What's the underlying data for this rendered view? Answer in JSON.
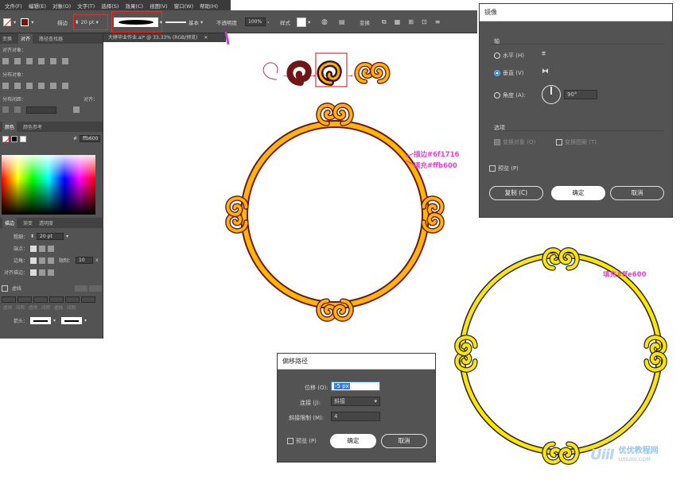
{
  "menubar": [
    "文件(F)",
    "编辑(E)",
    "对象(O)",
    "文字(T)",
    "选择(S)",
    "效果(C)",
    "视图(V)",
    "窗口(W)",
    "帮助(H)"
  ],
  "controlbar": {
    "stroke_label": "描边",
    "stroke_weight": "20 pt",
    "profile": "基本",
    "opacity_label": "不透明度",
    "opacity_value": "100%",
    "style_label": "样式",
    "transform": "变换"
  },
  "document_tab": "大婷毕业作业.ai* @ 33.33% (RGB/预览)",
  "left_panel": {
    "tabs": [
      "变换",
      "对齐",
      "路径查找器"
    ],
    "align_objects": "对齐对象：",
    "distribute_objects": "分布对象：",
    "distribute_spacing": "分布间距：",
    "align_to": "对齐：",
    "color_tabs": [
      "颜色",
      "颜色参考"
    ],
    "hex": "ffb600",
    "stroke_tabs": [
      "描边",
      "渐变",
      "透明度"
    ],
    "weight_label": "粗细：",
    "weight_value": "20 pt",
    "cap_label": "端点：",
    "corner_label": "边角：",
    "limit_label": "限制：",
    "limit_value": "10",
    "align_stroke": "对齐描边：",
    "dashed": "虚线",
    "dash_labels": [
      "虚线",
      "间隙",
      "虚线",
      "间隙",
      "虚线",
      "间隙"
    ],
    "arrow_label": "箭头："
  },
  "annotations": {
    "stroke_color": "描边#6f1716",
    "fill_color": "填充#ffb600",
    "fill_yellow": "填充#ffe600"
  },
  "colors": {
    "dark_brown": "#6f1716",
    "orange": "#ffb600",
    "yellow": "#ffe600",
    "magenta": "#f23cd2"
  },
  "mirror_dialog": {
    "title": "镜像",
    "axis_label": "轴",
    "horizontal": "水平 (H)",
    "vertical": "垂直 (V)",
    "angle": "角度 (A):",
    "angle_value": "90°",
    "options_label": "选项",
    "transform_objects": "变换对象 (O)",
    "transform_patterns": "变换图案 (T)",
    "preview": "预览 (P)",
    "copy_button": "复制 (C)",
    "ok_button": "确定",
    "cancel_button": "取消"
  },
  "offset_dialog": {
    "title": "偏移路径",
    "offset_label": "位移 (O):",
    "offset_value": "-5 px",
    "joins_label": "连接 (J):",
    "joins_value": "斜接",
    "miter_label": "斜接限制 (M):",
    "miter_value": "4",
    "preview": "预览 (P)",
    "ok_button": "确定",
    "cancel_button": "取消"
  },
  "watermark": {
    "brand": "优优教程网",
    "url": "UIIIUIIII.COM"
  }
}
